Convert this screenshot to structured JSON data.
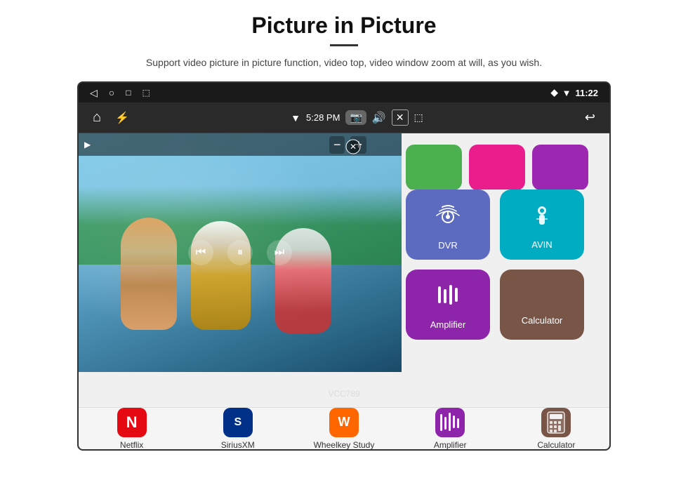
{
  "header": {
    "title": "Picture in Picture",
    "divider": true,
    "subtitle": "Support video picture in picture function, video top, video window zoom at will, as you wish."
  },
  "statusBar": {
    "back": "◁",
    "home": "○",
    "recent": "□",
    "screenshot": "⬚",
    "wifi": "▼",
    "location": "◆",
    "time": "11:22"
  },
  "navBar": {
    "home_icon": "⌂",
    "usb_icon": "⚡",
    "wifi_icon": "▼",
    "time": "5:28 PM",
    "camera_icon": "📷",
    "volume_icon": "🔊",
    "close_icon": "✕",
    "pip_icon": "⬚",
    "back_icon": "↩"
  },
  "pip": {
    "controls_minus": "−",
    "controls_plus": "+",
    "controls_close": "✕",
    "play_prev": "⏮",
    "play_pause": "⏸",
    "play_next": "⏭"
  },
  "apps": {
    "partial_row": [
      {
        "color": "green",
        "label": ""
      },
      {
        "color": "pink",
        "label": ""
      },
      {
        "color": "purple",
        "label": ""
      }
    ],
    "main_row1": [
      {
        "label": "DVR",
        "color": "blue",
        "icon": "dvr"
      },
      {
        "label": "AVIN",
        "color": "teal",
        "icon": "avin"
      }
    ],
    "main_row2": [
      {
        "label": "Amplifier",
        "color": "purple2",
        "icon": "amplifier"
      },
      {
        "label": "Calculator",
        "color": "brown",
        "icon": "calculator"
      }
    ]
  },
  "bottomBar": {
    "items": [
      {
        "label": "Netflix",
        "color": "#e50914",
        "icon": "N"
      },
      {
        "label": "SiriusXM",
        "color": "#003087",
        "icon": "S"
      },
      {
        "label": "Wheelkey Study",
        "color": "#ff6600",
        "icon": "W"
      },
      {
        "label": "Amplifier",
        "color": "#8e24aa",
        "icon": "≡"
      },
      {
        "label": "Calculator",
        "color": "#795548",
        "icon": "🖩"
      }
    ]
  },
  "watermark": "VCC789"
}
